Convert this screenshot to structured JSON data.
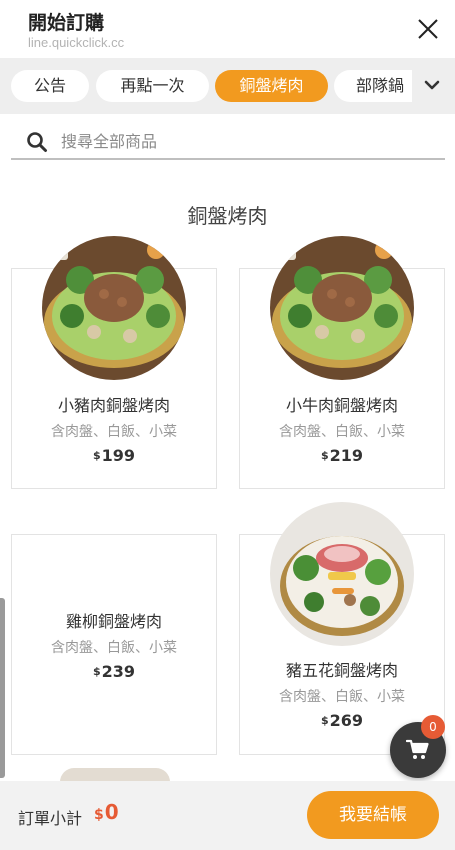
{
  "header": {
    "title": "開始訂購",
    "url": "line.quickclick.cc"
  },
  "tabs": [
    {
      "label": "公告",
      "active": false
    },
    {
      "label": "再點一次",
      "active": false
    },
    {
      "label": "銅盤烤肉",
      "active": true
    },
    {
      "label": "部隊鍋",
      "active": false
    }
  ],
  "search": {
    "placeholder": "搜尋全部商品",
    "value": ""
  },
  "section": {
    "title": "銅盤烤肉"
  },
  "products": [
    {
      "name": "小豬肉銅盤烤肉",
      "desc": "含肉盤、白飯、小菜",
      "currency": "$",
      "price": "199",
      "image": "pork-bbq-plate"
    },
    {
      "name": "小牛肉銅盤烤肉",
      "desc": "含肉盤、白飯、小菜",
      "currency": "$",
      "price": "219",
      "image": "beef-bbq-plate"
    },
    {
      "name": "雞柳銅盤烤肉",
      "desc": "含肉盤、白飯、小菜",
      "currency": "$",
      "price": "239",
      "image": ""
    },
    {
      "name": "豬五花銅盤烤肉",
      "desc": "含肉盤、白飯、小菜",
      "currency": "$",
      "price": "269",
      "image": "pork-belly-bbq-plate"
    }
  ],
  "cart": {
    "count": "0"
  },
  "bottom": {
    "subtotal_label": "訂單小計",
    "currency": "$",
    "subtotal": "0",
    "checkout_label": "我要結帳"
  },
  "colors": {
    "accent": "#f29a1f",
    "price_red": "#e65b35",
    "tabbar_bg": "#eeeeee"
  }
}
